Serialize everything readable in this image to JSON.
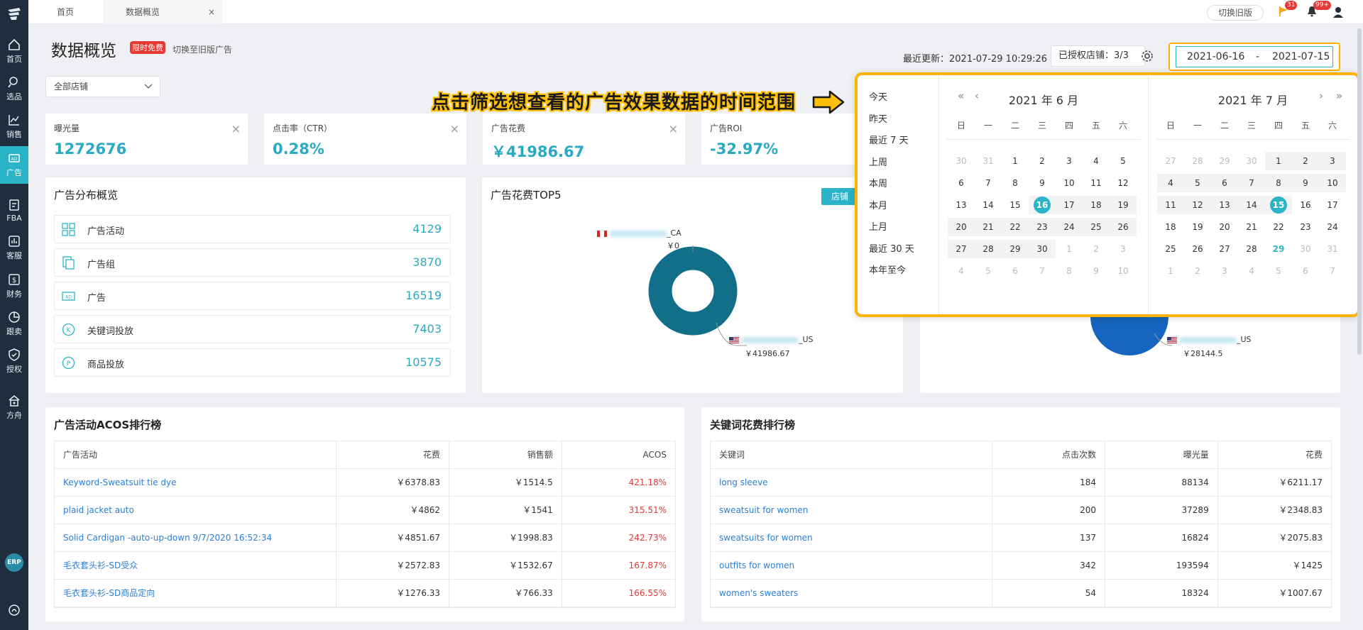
{
  "sidebar": {
    "items": [
      {
        "label": "首页",
        "icon": "home-icon"
      },
      {
        "label": "选品",
        "icon": "search-icon"
      },
      {
        "label": "销售",
        "icon": "chart-line-icon"
      },
      {
        "label": "广告",
        "icon": "ad-icon",
        "active": true
      },
      {
        "label": "FBA",
        "icon": "fba-icon"
      },
      {
        "label": "客服",
        "icon": "service-icon"
      },
      {
        "label": "财务",
        "icon": "finance-icon"
      },
      {
        "label": "跟卖",
        "icon": "pie-icon"
      },
      {
        "label": "授权",
        "icon": "shield-icon"
      },
      {
        "label": "方舟",
        "icon": "ark-icon"
      }
    ],
    "erp_label": "ERP"
  },
  "tabs": {
    "home": "首页",
    "current": "数据概览",
    "close": "×"
  },
  "topbar": {
    "old_version": "切换旧版",
    "flag_badge": "31",
    "bell_badge": "99+"
  },
  "header": {
    "title": "数据概览",
    "free_badge": "限时免费",
    "switch_link": "切换至旧版广告",
    "store_select": "全部店铺",
    "last_update": "最近更新：2021-07-29 10:29:26",
    "authorized": "已授权店铺：3/3",
    "date_start": "2021-06-16",
    "date_sep": "-",
    "date_end": "2021-07-15"
  },
  "metrics": [
    {
      "label": "曝光量",
      "value": "1272676"
    },
    {
      "label": "点击率（CTR）",
      "value": "0.28%"
    },
    {
      "label": "广告花费",
      "value": "￥41986.67"
    },
    {
      "label": "广告ROI",
      "value": "-32.97%"
    }
  ],
  "distribution": {
    "title": "广告分布概览",
    "rows": [
      {
        "label": "广告活动",
        "value": "4129",
        "icon": "grid-icon"
      },
      {
        "label": "广告组",
        "value": "3870",
        "icon": "copy-icon"
      },
      {
        "label": "广告",
        "value": "16519",
        "icon": "ad-box-icon"
      },
      {
        "label": "关键词投放",
        "value": "7403",
        "icon": "k-circle-icon"
      },
      {
        "label": "商品投放",
        "value": "10575",
        "icon": "p-circle-icon"
      }
    ]
  },
  "top5": {
    "title": "广告花费TOP5",
    "store_btn": "店铺",
    "ca_suffix": "_CA",
    "ca_value": "￥0",
    "us_suffix": "_US",
    "us_value": "￥41986.67",
    "us2_suffix": "_US",
    "us2_value": "￥28144.5"
  },
  "chart_data": {
    "type": "pie",
    "categories": [
      "_CA",
      "_US"
    ],
    "values": [
      0,
      41986.67
    ]
  },
  "annotation": "点击筛选想查看的广告效果数据的时间范围",
  "picker": {
    "shortcuts": [
      "今天",
      "昨天",
      "最近 7 天",
      "上周",
      "本周",
      "本月",
      "上月",
      "最近 30 天",
      "本年至今"
    ],
    "weekdays": [
      "日",
      "一",
      "二",
      "三",
      "四",
      "五",
      "六"
    ],
    "left": {
      "title": "2021 年 6 月",
      "nav_prev_year": "«",
      "nav_prev": "‹",
      "days": [
        [
          "30",
          "31",
          "1",
          "2",
          "3",
          "4",
          "5"
        ],
        [
          "6",
          "7",
          "8",
          "9",
          "10",
          "11",
          "12"
        ],
        [
          "13",
          "14",
          "15",
          "16",
          "17",
          "18",
          "19"
        ],
        [
          "20",
          "21",
          "22",
          "23",
          "24",
          "25",
          "26"
        ],
        [
          "27",
          "28",
          "29",
          "30",
          "1",
          "2",
          "3"
        ],
        [
          "4",
          "5",
          "6",
          "7",
          "8",
          "9",
          "10"
        ]
      ]
    },
    "right": {
      "title": "2021 年 7 月",
      "nav_next": "›",
      "nav_next_year": "»",
      "days": [
        [
          "27",
          "28",
          "29",
          "30",
          "1",
          "2",
          "3"
        ],
        [
          "4",
          "5",
          "6",
          "7",
          "8",
          "9",
          "10"
        ],
        [
          "11",
          "12",
          "13",
          "14",
          "15",
          "16",
          "17"
        ],
        [
          "18",
          "19",
          "20",
          "21",
          "22",
          "23",
          "24"
        ],
        [
          "25",
          "26",
          "27",
          "28",
          "29",
          "30",
          "31"
        ],
        [
          "1",
          "2",
          "3",
          "4",
          "5",
          "6",
          "7"
        ]
      ]
    }
  },
  "acos": {
    "title": "广告活动ACOS排行榜",
    "headers": [
      "广告活动",
      "花费",
      "销售额",
      "ACOS"
    ],
    "rows": [
      [
        "Keyword-Sweatsuit tie dye",
        "￥6378.83",
        "￥1514.5",
        "421.18%"
      ],
      [
        "plaid jacket auto",
        "￥4862",
        "￥1541",
        "315.51%"
      ],
      [
        "Solid Cardigan -auto-up-down 9/7/2020 16:52:34",
        "￥4851.67",
        "￥1998.83",
        "242.73%"
      ],
      [
        "毛衣套头衫-SD受众",
        "￥2572.83",
        "￥1532.67",
        "167.87%"
      ],
      [
        "毛衣套头衫-SD商品定向",
        "￥1276.33",
        "￥766.33",
        "166.55%"
      ]
    ]
  },
  "keywords": {
    "title": "关键词花费排行榜",
    "headers": [
      "关键词",
      "点击次数",
      "曝光量",
      "花费"
    ],
    "rows": [
      [
        "long sleeve",
        "184",
        "88134",
        "￥6211.17"
      ],
      [
        "sweatsuit for women",
        "200",
        "37289",
        "￥2348.83"
      ],
      [
        "sweatsuits for women",
        "137",
        "16824",
        "￥2075.83"
      ],
      [
        "outfits for women",
        "342",
        "193594",
        "￥1425"
      ],
      [
        "women's sweaters",
        "54",
        "18324",
        "￥1007.67"
      ]
    ]
  },
  "colors": {
    "accent": "#2bb3c8",
    "sidebar": "#1f2d3d",
    "donut": "#116f8a",
    "highlight": "#ffb300",
    "negative": "#e53935",
    "link": "#2b7fd6"
  }
}
